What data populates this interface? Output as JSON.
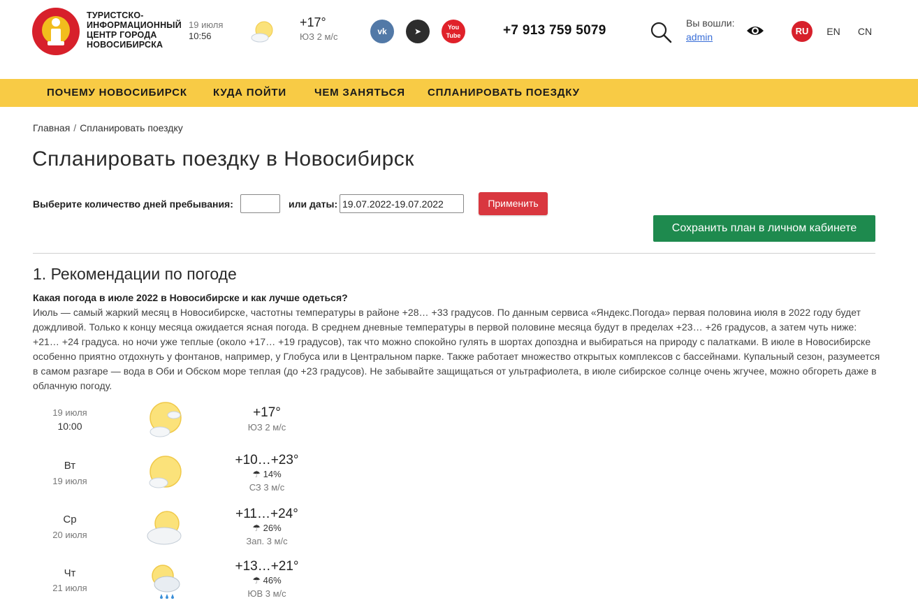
{
  "header": {
    "org_name": "ТУРИСТСКО-ИНФОРМАЦИОННЫЙ ЦЕНТР ГОРОДА НОВОСИБИРСКА",
    "date": "19 июля",
    "time": "10:56",
    "temp": "+17°",
    "wind": "ЮЗ 2 м/с",
    "social": [
      {
        "name": "vk",
        "icon": "vk-icon",
        "label": "vk"
      },
      {
        "name": "telegram",
        "icon": "telegram-icon",
        "label": "➤"
      },
      {
        "name": "youtube",
        "icon": "youtube-icon",
        "label": "You Tube"
      }
    ],
    "phone": "+7 913 759 5079",
    "login_label": "Вы вошли:",
    "login_user": "admin",
    "languages": [
      {
        "code": "RU",
        "active": true
      },
      {
        "code": "EN",
        "active": false
      },
      {
        "code": "CN",
        "active": false
      }
    ]
  },
  "nav": {
    "items": [
      "ПОЧЕМУ НОВОСИБИРСК",
      "КУДА ПОЙТИ",
      "ЧЕМ ЗАНЯТЬСЯ",
      "СПЛАНИРОВАТЬ ПОЕЗДКУ"
    ]
  },
  "breadcrumb": {
    "home": "Главная",
    "separator": "/",
    "current": "Спланировать поездку"
  },
  "page_title": "Спланировать поездку в Новосибирск",
  "planner": {
    "days_label": "Выберите количество дней пребывания:",
    "days_value": "",
    "dates_label": "или даты:",
    "dates_value": "19.07.2022-19.07.2022",
    "apply_label": "Применить",
    "save_label": "Сохранить план в личном кабинете"
  },
  "weather_section": {
    "title": "1. Рекомендации по погоде",
    "question": "Какая погода в июле 2022 в Новосибирске и как лучше одеться?",
    "paragraph": "Июль — самый жаркий месяц в Новосибирске, частотны температуры в районе +28… +33 градусов. По данным сервиса «Яндекс.Погода» первая половина июля в 2022 году будет дождливой. Только к концу месяца ожидается ясная погода. В среднем дневные температуры в первой половине месяца будут в пределах +23… +26 градусов, а затем чуть ниже: +21… +24 градуса. но ночи уже теплые (около +17… +19 градусов), так что можно спокойно гулять в шортах допоздна и выбираться на природу с палатками. В июле в Новосибирске особенно приятно отдохнуть у фонтанов, например, у Глобуса или в Центральном парке. Также работает множество открытых комплексов с бассейнами. Купальный сезон, разумеется в самом разгаре — вода в Оби и Обском море теплая (до +23 градусов). Не забывайте защищаться от ультрафиолета, в июле сибирское солнце очень жгучее, можно обгореть даже в облачную погоду."
  },
  "forecast": [
    {
      "day": "19 июля",
      "sub": "10:00",
      "icon": "sun-cloud-icon",
      "temp": "+17°",
      "precip": "",
      "wind": "ЮЗ 2 м/с"
    },
    {
      "day": "Вт",
      "sub": "19 июля",
      "icon": "sun-cloud-icon",
      "temp": "+10…+23°",
      "precip": "☂ 14%",
      "wind": "СЗ 3 м/с"
    },
    {
      "day": "Ср",
      "sub": "20 июля",
      "icon": "cloud-sun-icon",
      "temp": "+11…+24°",
      "precip": "☂ 26%",
      "wind": "Зап. 3 м/с"
    },
    {
      "day": "Чт",
      "sub": "21 июля",
      "icon": "rain-cloud-icon",
      "temp": "+13…+21°",
      "precip": "☂ 46%",
      "wind": "ЮВ 3 м/с"
    }
  ],
  "colors": {
    "nav_bg": "#f8cb45",
    "apply_btn": "#d9373f",
    "save_btn": "#1e8a4e",
    "logo_red": "#d7202b",
    "link": "#3a6fd8"
  }
}
